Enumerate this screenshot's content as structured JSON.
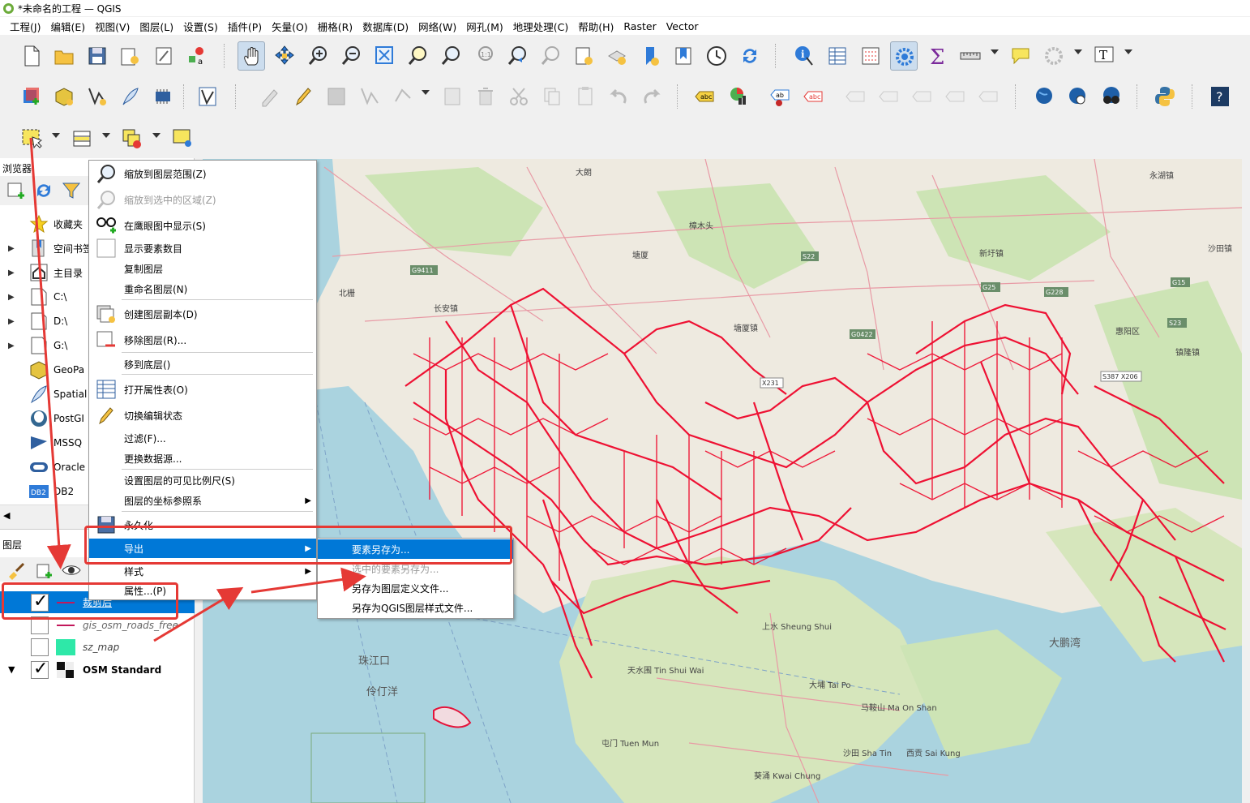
{
  "window": {
    "title": "*未命名的工程 — QGIS"
  },
  "menubar": [
    "工程(J)",
    "编辑(E)",
    "视图(V)",
    "图层(L)",
    "设置(S)",
    "插件(P)",
    "矢量(O)",
    "栅格(R)",
    "数据库(D)",
    "网络(W)",
    "网孔(M)",
    "地理处理(C)",
    "帮助(H)",
    "Raster",
    "Vector"
  ],
  "browser": {
    "title": "浏览器",
    "items": [
      {
        "label": "收藏夹",
        "icon": "star-icon",
        "expandable": false
      },
      {
        "label": "空间书签",
        "icon": "bookmark-icon",
        "expandable": true
      },
      {
        "label": "主目录",
        "icon": "home-icon",
        "expandable": true
      },
      {
        "label": "C:\\",
        "icon": "drive-icon",
        "expandable": true
      },
      {
        "label": "D:\\",
        "icon": "drive-icon",
        "expandable": true
      },
      {
        "label": "G:\\",
        "icon": "drive-icon",
        "expandable": true
      },
      {
        "label": "GeoPa",
        "icon": "geopackage-icon",
        "expandable": false
      },
      {
        "label": "Spatial",
        "icon": "spatialite-icon",
        "expandable": false
      },
      {
        "label": "PostGI",
        "icon": "postgis-icon",
        "expandable": false
      },
      {
        "label": "MSSQ",
        "icon": "mssql-icon",
        "expandable": false
      },
      {
        "label": "Oracle",
        "icon": "oracle-icon",
        "expandable": false
      },
      {
        "label": "DB2",
        "icon": "db2-icon",
        "expandable": false,
        "badge": "DB2"
      }
    ]
  },
  "layers": {
    "title": "图层",
    "items": [
      {
        "name": "裁剪后",
        "checked": true,
        "selected": true
      },
      {
        "name": "gis_osm_roads_free",
        "checked": false,
        "selected": false
      },
      {
        "name": "sz_map",
        "checked": false,
        "selected": false
      },
      {
        "name": "OSM Standard",
        "checked": true,
        "selected": false
      }
    ]
  },
  "context_menu": {
    "items": [
      {
        "label": "缩放到图层范围(Z)",
        "icon": "zoom-layer-icon",
        "disabled": false
      },
      {
        "label": "缩放到选中的区域(Z)",
        "icon": "zoom-selected-icon",
        "disabled": true
      },
      {
        "label": "在鹰眼图中显示(S)",
        "icon": "overview-glasses-icon",
        "disabled": false
      },
      {
        "label": "显示要素数目",
        "icon": "checkbox-icon",
        "disabled": false
      },
      {
        "label": "复制图层",
        "icon": "",
        "disabled": false
      },
      {
        "label": "重命名图层(N)",
        "icon": "",
        "disabled": false
      },
      {
        "label": "创建图层副本(D)",
        "icon": "duplicate-layer-icon",
        "disabled": false
      },
      {
        "label": "移除图层(R)...",
        "icon": "remove-layer-icon",
        "disabled": false
      },
      {
        "label": "移到底层()",
        "icon": "",
        "disabled": false
      },
      {
        "label": "打开属性表(O)",
        "icon": "attribute-table-icon",
        "disabled": false
      },
      {
        "label": "切换编辑状态",
        "icon": "pencil-icon",
        "disabled": false
      },
      {
        "label": "过滤(F)...",
        "icon": "",
        "disabled": false
      },
      {
        "label": "更换数据源...",
        "icon": "",
        "disabled": false
      },
      {
        "label": "设置图层的可见比例尺(S)",
        "icon": "",
        "disabled": false
      },
      {
        "label": "图层的坐标参照系",
        "icon": "",
        "disabled": false,
        "submenu": true
      },
      {
        "label": "永久化",
        "icon": "save-icon",
        "disabled": false
      },
      {
        "label": "导出",
        "icon": "",
        "disabled": false,
        "submenu": true,
        "highlight": true
      },
      {
        "label": "样式",
        "icon": "",
        "disabled": false,
        "submenu": true
      },
      {
        "label": "属性...(P)",
        "icon": "",
        "disabled": false
      }
    ]
  },
  "export_submenu": {
    "items": [
      {
        "label": "要素另存为...",
        "highlight": true,
        "disabled": false
      },
      {
        "label": "选中的要素另存为...",
        "highlight": false,
        "disabled": true
      },
      {
        "label": "另存为图层定义文件...",
        "highlight": false,
        "disabled": false
      },
      {
        "label": "另存为QGIS图层样式文件...",
        "highlight": false,
        "disabled": false
      }
    ]
  },
  "map": {
    "labels": [
      "大朗",
      "塘厦",
      "樟木头",
      "新圩镇",
      "惠阳区",
      "长安镇",
      "北栅",
      "塘厦镇",
      "沙田镇",
      "永湖镇",
      "珠江口",
      "伶仃洋",
      "上水 Sheung Shui",
      "天水围 Tin Shui Wai",
      "屯门 Tuen Mun",
      "大埔 Tai Po",
      "沙田 Sha Tin",
      "西贡 Sai Kung",
      "马鞍山 Ma On Shan",
      "大鹏湾",
      "葵涌 Kwai Chung",
      "镇隆镇"
    ],
    "road_shields": [
      "G9411",
      "S22",
      "G25",
      "G228",
      "G15",
      "S23",
      "X231",
      "S387 X206",
      "G0422"
    ],
    "colors": {
      "roads": "#ee1133",
      "land": "#eeeae0",
      "green": "#b9d49d",
      "water": "#aad3df"
    }
  }
}
